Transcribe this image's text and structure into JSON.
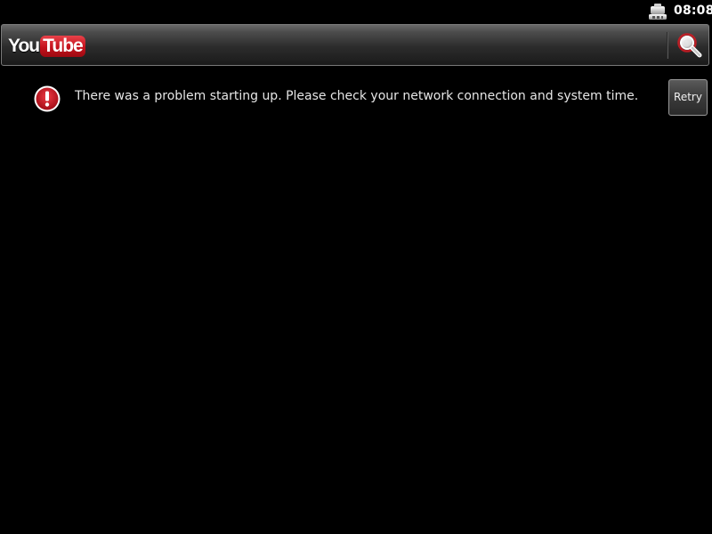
{
  "status_bar": {
    "time": "08:08",
    "notification_icon": "android-debug-icon"
  },
  "app_bar": {
    "logo_you": "You",
    "logo_tube": "Tube",
    "search_icon": "search-icon",
    "logo_colors": {
      "tube_red": "#cc181e",
      "text": "#ffffff"
    }
  },
  "error": {
    "icon": "error-alert-icon",
    "message": "There was a problem starting up. Please check your network connection and system time.",
    "retry_label": "Retry",
    "icon_color": "#c8102e"
  }
}
